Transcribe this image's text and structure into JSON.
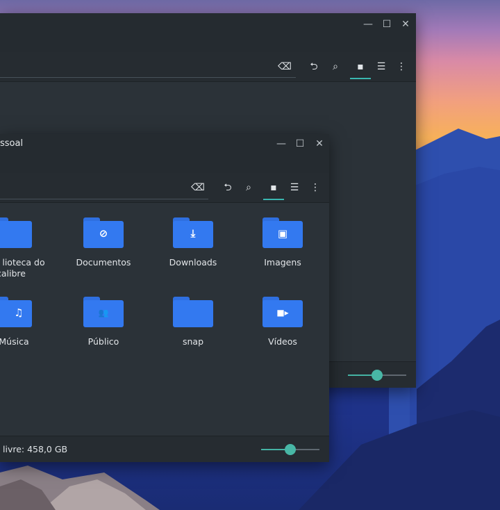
{
  "back_window": {
    "controls": {
      "minimize": "—",
      "maximize": "☐",
      "close": "✕"
    }
  },
  "front_window": {
    "title": "ssoal",
    "controls": {
      "minimize": "—",
      "maximize": "☐",
      "close": "✕"
    },
    "folders": [
      {
        "label": "lioteca do",
        "label2": "calibre",
        "icon": "library-folder-icon",
        "glyph": ""
      },
      {
        "label": "Documentos",
        "label2": "",
        "icon": "documents-folder-icon",
        "glyph": "⊘"
      },
      {
        "label": "Downloads",
        "label2": "",
        "icon": "downloads-folder-icon",
        "glyph": "⤓"
      },
      {
        "label": "Imagens",
        "label2": "",
        "icon": "images-folder-icon",
        "glyph": "▣"
      },
      {
        "label": "Música",
        "label2": "",
        "icon": "music-folder-icon",
        "glyph": "♫"
      },
      {
        "label": "Público",
        "label2": "",
        "icon": "public-folder-icon",
        "glyph": "👥"
      },
      {
        "label": "snap",
        "label2": "",
        "icon": "snap-folder-icon",
        "glyph": ""
      },
      {
        "label": "Vídeos",
        "label2": "",
        "icon": "videos-folder-icon",
        "glyph": "■▸"
      }
    ],
    "status": "livre: 458,0 GB"
  },
  "zoom": {
    "back": 0.5,
    "front": 0.5
  },
  "colors": {
    "accent": "#3ab7b0",
    "folder": "#3379f0",
    "window_bg": "#2b3238"
  }
}
